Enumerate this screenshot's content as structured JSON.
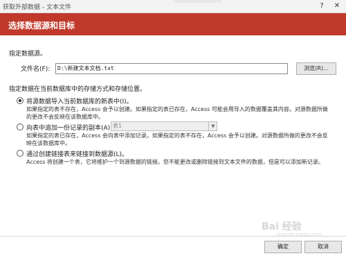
{
  "window": {
    "title": "获取外部数据 - 文本文件",
    "help_label": "?",
    "close_label": "✕"
  },
  "header": {
    "title": "选择数据源和目标"
  },
  "source": {
    "heading": "指定数据源。",
    "filename_label": "文件名(F):",
    "filename_value": "D:\\新建文本文档.txt",
    "browse_label": "浏览(R)..."
  },
  "storage": {
    "heading": "指定数据在当前数据库中的存储方式和存储位置。",
    "options": [
      {
        "label": "将源数据导入当前数据库的新表中(I)。",
        "desc1": "如果指定的表不存在，Access 会予以创建。如果指定的表已存在，Access 可能会用导入的数据覆盖其内容。对源数据所做",
        "desc2": "的更改不会反映在该数据库中。",
        "selected": true
      },
      {
        "label": "向表中追加一份记录的副本(A):",
        "select_value": "表1",
        "desc1": "如果指定的表已存在，Access 会向表中添加记录。如果指定的表不存在，Access 会予以创建。对源数据所做的更改不会反",
        "desc2": "映在该数据库中。",
        "selected": false
      },
      {
        "label": "通过创建链接表来链接到数据源(L)。",
        "desc1": "Access 将创建一个表，它将维护一个到源数据的链接。您不能更改或删除链接到文本文件的数据，但是可以添加新记录。",
        "selected": false
      }
    ]
  },
  "footer": {
    "ok_label": "确定",
    "cancel_label": "取消"
  },
  "watermark": {
    "text": "Bai 经验",
    "sub": "jingyan.baidu.com"
  }
}
